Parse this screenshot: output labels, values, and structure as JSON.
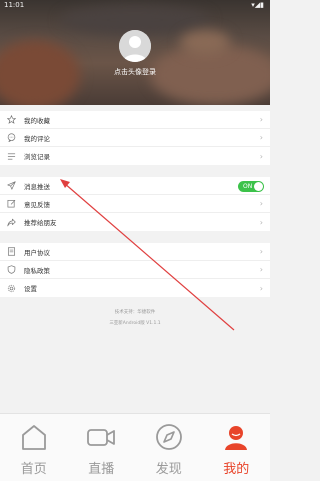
{
  "status": {
    "time": "11:01",
    "battery": "▾◢▮"
  },
  "header": {
    "login_text": "点击头像登录"
  },
  "groups": [
    {
      "items": [
        {
          "label": "我的收藏",
          "icon": "star-icon"
        },
        {
          "label": "我的评论",
          "icon": "comment-icon"
        },
        {
          "label": "浏览记录",
          "icon": "history-list-icon"
        }
      ]
    },
    {
      "items": [
        {
          "label": "消息推送",
          "icon": "send-icon",
          "toggle": {
            "label": "ON",
            "state": true
          }
        },
        {
          "label": "意见反馈",
          "icon": "edit-icon"
        },
        {
          "label": "推荐给朋友",
          "icon": "share-icon"
        }
      ]
    },
    {
      "items": [
        {
          "label": "用户协议",
          "icon": "document-icon"
        },
        {
          "label": "隐私政策",
          "icon": "shield-icon"
        },
        {
          "label": "设置",
          "icon": "gear-icon"
        }
      ]
    }
  ],
  "footer": {
    "tech_support": "技术支持：华捷软件",
    "version": "三亚新Android版 V1.1.1"
  },
  "tabs": [
    {
      "label": "首页",
      "icon": "home-icon",
      "active": false
    },
    {
      "label": "直播",
      "icon": "video-camera-icon",
      "active": false
    },
    {
      "label": "发现",
      "icon": "compass-icon",
      "active": false
    },
    {
      "label": "我的",
      "icon": "user-icon",
      "active": true
    }
  ],
  "colors": {
    "accent": "#e8442a",
    "toggle_on": "#3cc24a",
    "annotation_arrow": "#e04040"
  }
}
